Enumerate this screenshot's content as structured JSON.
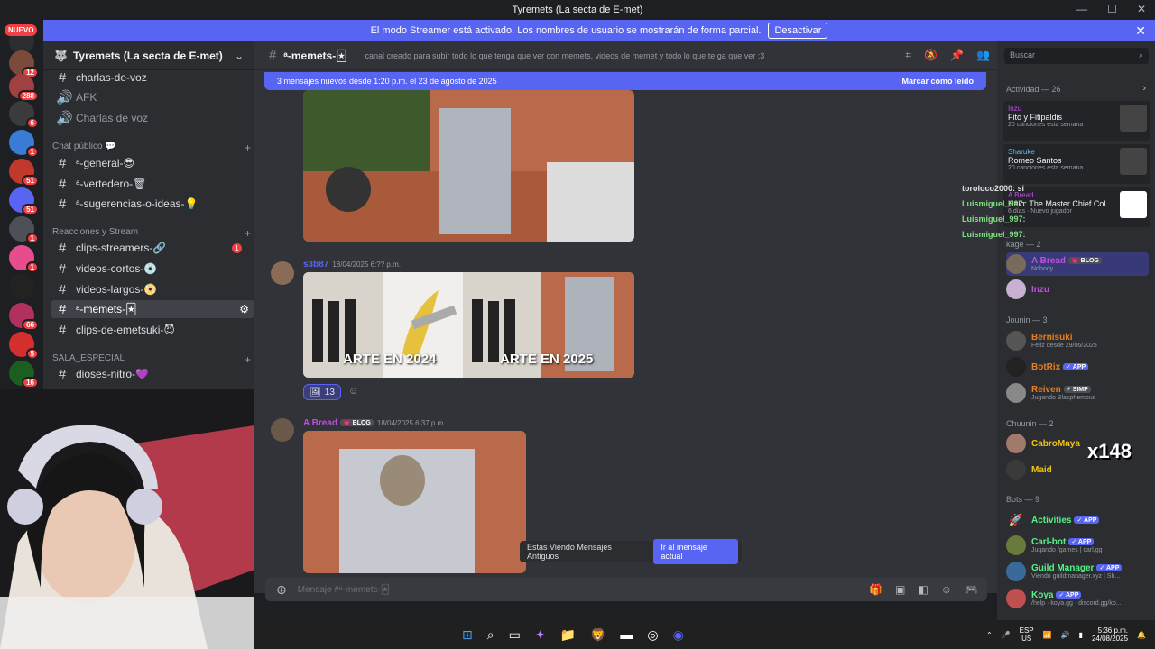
{
  "window": {
    "title": "Tyremets (La secta de E-met)",
    "min": "—",
    "max": "☐",
    "close": "✕"
  },
  "banner": {
    "text": "El modo Streamer está activado. Los nombres de usuario se mostrarán de forma parcial.",
    "button": "Desactivar"
  },
  "rail": {
    "nuevo": "NUEVO",
    "badges": [
      "12",
      "288",
      "6",
      "1",
      "51",
      "51",
      "1",
      "1",
      "66",
      "5",
      "16"
    ]
  },
  "server": {
    "name": "Tyremets (La secta de E-met)"
  },
  "channels": {
    "voice": [
      "charlas-de-voz",
      "AFK",
      "Charlas de voz"
    ],
    "cat_public": "Chat público 💬",
    "public": [
      "ᵃ-general-😎",
      "ᵃ-vertedero-🗑",
      "ᵃ-sugerencias-o-ideas-💡"
    ],
    "cat_reactions": "Reacciones y Stream",
    "reactions": [
      "clips-streamers-🔗",
      "videos-cortos-💿",
      "videos-largos-📀",
      "ᵃ-memets-🃏",
      "clips-de-emetsuki-😈"
    ],
    "unread": "1",
    "cat_special": "SALA_ESPECIAL",
    "special": [
      "dioses-nitro-💜"
    ]
  },
  "header": {
    "channel": "ᵃ-memets-🃏",
    "topic": "canal creado para subir todo lo que tenga que ver con memets, videos de memet y todo lo que te ga que ver :3",
    "search_placeholder": "Buscar"
  },
  "newbar": {
    "text": "3 mensajes nuevos desde 1:20 p.m. el 23 de agosto de 2025",
    "mark": "Marcar como leído"
  },
  "messages": [
    {
      "author": "s3b87",
      "timestamp": "18/04/2025 6:?? p.m.",
      "captions": [
        "ARTE EN 2024",
        "ARTE EN 2025"
      ],
      "reaction_count": "13"
    },
    {
      "author": "A Bread",
      "tag": "💗 BLOG",
      "timestamp": "18/04/2025 6:37 p.m."
    }
  ],
  "old_messages": {
    "text": "Estás Viendo Mensajes Antiguos",
    "button": "Ir al mensaje actual"
  },
  "composer": {
    "placeholder": "Mensaje #ᵃ-memets-🃏"
  },
  "overlay_chat": [
    {
      "name": "toroloco2000",
      "msg": ": si",
      "color": "#e0e0e0"
    },
    {
      "name": "Luismiguel_997",
      "msg": ":",
      "color": "#7ee07e"
    },
    {
      "name": "Luismiguel_997",
      "msg": ":",
      "color": "#7ee07e"
    },
    {
      "name": "Luismiguel_997",
      "msg": ":",
      "color": "#7ee07e"
    }
  ],
  "members": {
    "activity_title": "Actividad — 26",
    "activities": [
      {
        "user": "Inzu",
        "title": "Fito y Fitipaldis",
        "sub": "20 canciones esta semana"
      },
      {
        "user": "Sharuke",
        "title": "Romeo Santos",
        "sub": "20 canciones esta semana"
      },
      {
        "user": "A Bread",
        "title": "Halo: The Master Chief Col...",
        "sub": "6 días · Nuevo jugador"
      }
    ],
    "kage": "kage — 2",
    "kage_list": [
      {
        "name": "A Bread",
        "tag": "💗 BLOG",
        "sub": "Nobody",
        "color": "#c04fe0"
      },
      {
        "name": "Inzu",
        "tag": "",
        "sub": "",
        "color": "#c04fe0"
      }
    ],
    "jounin": "Jounin — 3",
    "jounin_list": [
      {
        "name": "Bernisuki",
        "tag": "",
        "sub": "Feliz desde 29/06/2025",
        "color": "#e67e22"
      },
      {
        "name": "BotRix",
        "tag": "✓ APP",
        "sub": "",
        "color": "#e67e22"
      },
      {
        "name": "Reiven",
        "tag": "⚡ SIMP",
        "sub": "Jugando Blasphemous",
        "color": "#e67e22"
      }
    ],
    "chuunin": "Chuunin — 2",
    "chuunin_list": [
      {
        "name": "CabroMaya",
        "tag": "",
        "sub": "",
        "color": "#f1c40f"
      },
      {
        "name": "Maid",
        "tag": "",
        "sub": "",
        "color": "#f1c40f"
      }
    ],
    "bots": "Bots — 9",
    "bot_list": [
      {
        "name": "Activities",
        "tag": "✓ APP",
        "sub": "",
        "color": "#57f287"
      },
      {
        "name": "Carl-bot",
        "tag": "✓ APP",
        "sub": "Jugando /games | carl.gg",
        "color": "#57f287"
      },
      {
        "name": "Guild Manager",
        "tag": "✓ APP",
        "sub": "Viendo guildmanager.xyz | Sh...",
        "color": "#57f287"
      },
      {
        "name": "Koya",
        "tag": "✓ APP",
        "sub": "/help · koya.gg · discord.gg/ko...",
        "color": "#57f287"
      }
    ],
    "overlay_count": "x148"
  },
  "taskbar": {
    "lang": "ESP",
    "lang2": "US",
    "time": "5:36 p.m.",
    "date": "24/08/2025"
  }
}
